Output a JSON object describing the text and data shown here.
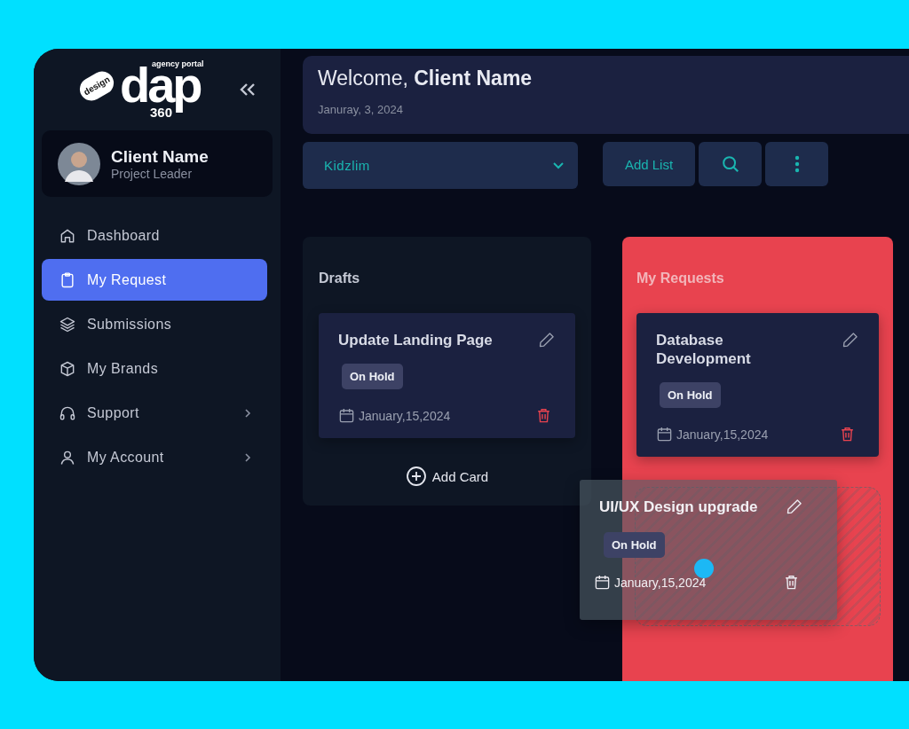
{
  "logo": {
    "tag": "design",
    "word": "dap",
    "subtitle": "agency portal",
    "number": "360"
  },
  "profile": {
    "name": "Client Name",
    "role": "Project Leader"
  },
  "nav": [
    {
      "label": "Dashboard",
      "kind": "home",
      "selected": false,
      "submenu": false
    },
    {
      "label": "My Request",
      "kind": "clipboard",
      "selected": true,
      "submenu": false
    },
    {
      "label": "Submissions",
      "kind": "layers",
      "selected": false,
      "submenu": false
    },
    {
      "label": "My Brands",
      "kind": "box",
      "selected": false,
      "submenu": false
    },
    {
      "label": "Support",
      "kind": "headset",
      "selected": false,
      "submenu": true
    },
    {
      "label": "My Account",
      "kind": "user",
      "selected": false,
      "submenu": true
    }
  ],
  "header": {
    "greeting": "Welcome, **Client Name**",
    "date": "Januray, 3, 2024"
  },
  "toolbar": {
    "dropdown": "Kidzlim",
    "add_list": "Add List"
  },
  "lists": [
    {
      "title": "Drafts",
      "highlighted": false,
      "drop_zone": false,
      "add_card": "Add Card",
      "cards": [
        {
          "title": "Update Landing Page",
          "status": "On Hold",
          "date": "January,15,2024"
        }
      ]
    },
    {
      "title": "My Requests",
      "highlighted": true,
      "drop_zone": true,
      "cards": [
        {
          "title": "Database Development",
          "status": "On Hold",
          "date": "January,15,2024"
        }
      ]
    }
  ],
  "dragged_card": {
    "title": "UI/UX Design upgrade",
    "status": "On Hold",
    "date": "January,15,2024"
  }
}
